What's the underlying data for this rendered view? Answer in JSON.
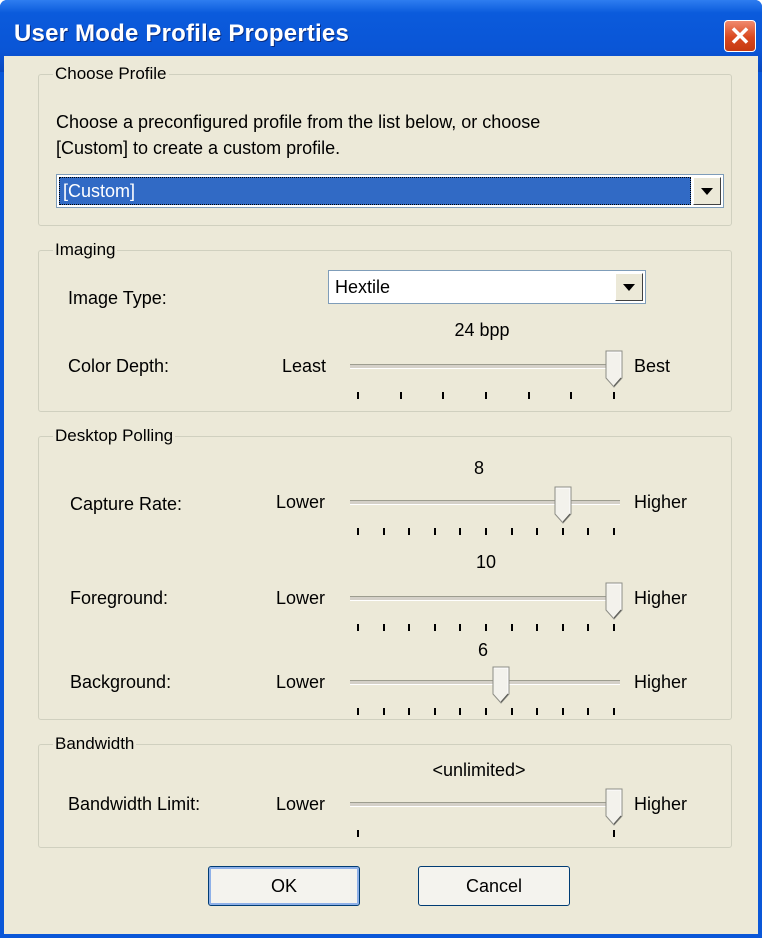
{
  "window": {
    "title": "User Mode Profile Properties",
    "close_glyph": "✕"
  },
  "choose_profile": {
    "legend": "Choose Profile",
    "instruction_line1": "Choose a preconfigured profile from the list below, or choose",
    "instruction_line2": "[Custom] to create a custom profile.",
    "selected": "[Custom]"
  },
  "imaging": {
    "legend": "Imaging",
    "image_type_label": "Image Type:",
    "image_type_value": "Hextile",
    "color_depth_label": "Color Depth:",
    "color_depth_value": "24 bpp",
    "color_depth_min_label": "Least",
    "color_depth_max_label": "Best",
    "color_depth_position": 1.0,
    "color_depth_ticks": 7
  },
  "desktop_polling": {
    "legend": "Desktop Polling",
    "capture_rate_label": "Capture Rate:",
    "capture_rate_value": "8",
    "capture_rate_position": 0.8,
    "capture_rate_ticks": 11,
    "foreground_label": "Foreground:",
    "foreground_value": "10",
    "foreground_position": 1.0,
    "foreground_ticks": 11,
    "background_label": "Background:",
    "background_value": "6",
    "background_position": 0.56,
    "background_ticks": 11,
    "min_label": "Lower",
    "max_label": "Higher"
  },
  "bandwidth": {
    "legend": "Bandwidth",
    "limit_label": "Bandwidth Limit:",
    "limit_value": "<unlimited>",
    "limit_position": 1.0,
    "limit_ticks": 2,
    "min_label": "Lower",
    "max_label": "Higher"
  },
  "buttons": {
    "ok": "OK",
    "cancel": "Cancel"
  },
  "icons": {
    "close": "close-icon",
    "dropdown": "chevron-down-icon"
  }
}
